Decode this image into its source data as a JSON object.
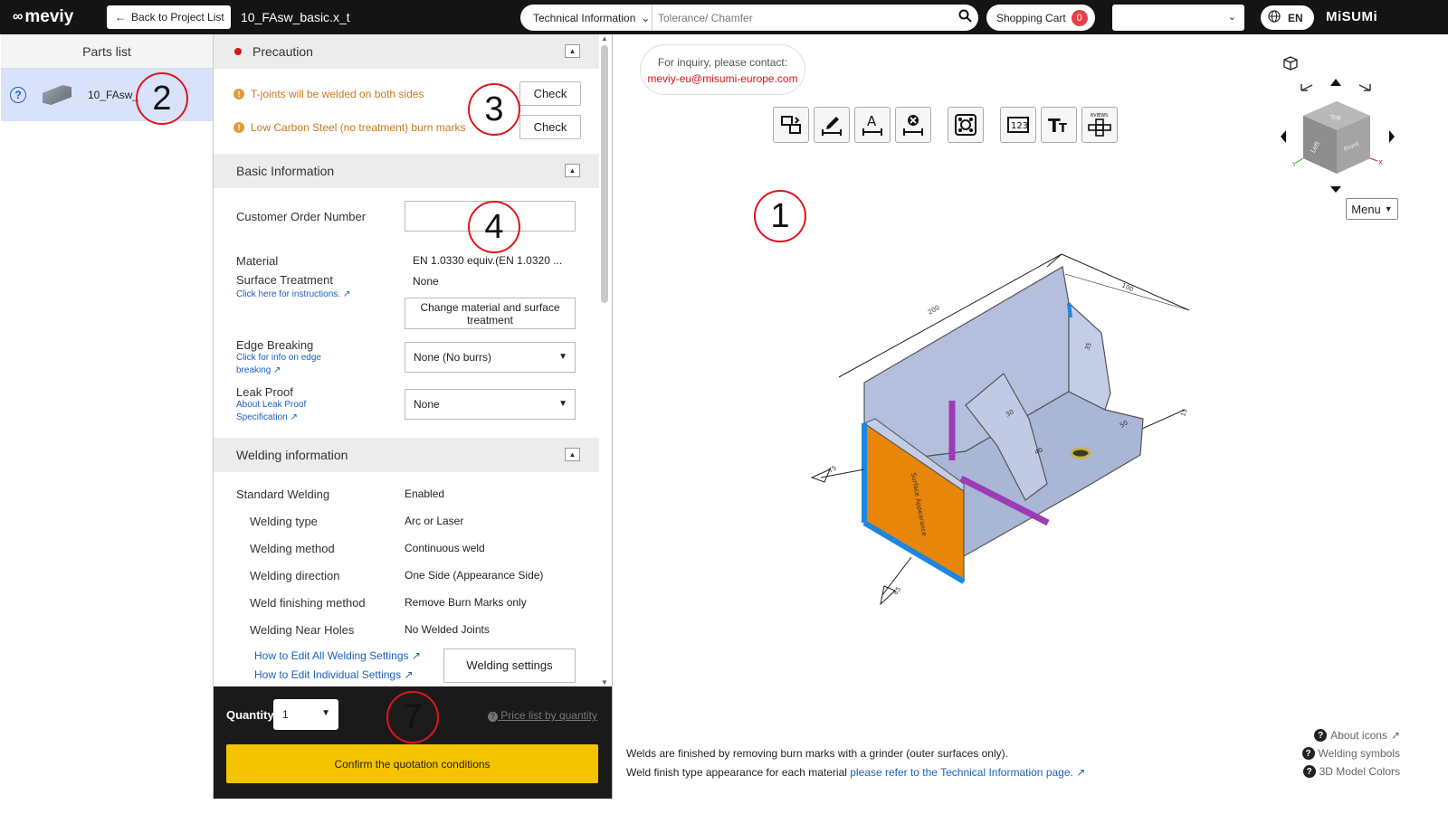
{
  "header": {
    "logo_text": "meviy",
    "back_label": "Back to Project List",
    "filename": "10_FAsw_basic.x_t",
    "search_category": "Technical Information",
    "search_placeholder": "Tolerance/ Chamfer",
    "cart_label": "Shopping Cart",
    "cart_count": "0",
    "language": "EN",
    "brand": "MiSUMi"
  },
  "parts": {
    "title": "Parts list",
    "item_label": "10_FAsw_"
  },
  "precaution": {
    "title": "Precaution",
    "items": [
      {
        "text": "T-joints will be welded on both sides",
        "button": "Check"
      },
      {
        "text": "Low Carbon Steel (no treatment) burn marks",
        "button": "Check"
      }
    ]
  },
  "basic": {
    "title": "Basic Information",
    "order_label": "Customer Order Number",
    "order_value": "",
    "material_label": "Material",
    "material_value": "EN 1.0330 equiv.(EN 1.0320 ...",
    "surface_label": "Surface Treatment",
    "surface_link": "Click here for instructions.",
    "surface_value": "None",
    "change_button": "Change material and surface treatment",
    "edge_label": "Edge Breaking",
    "edge_link": "Click for info on edge breaking",
    "edge_value": "None (No burrs)",
    "leak_label": "Leak Proof",
    "leak_link": "About Leak Proof Specification",
    "leak_value": "None"
  },
  "welding": {
    "title": "Welding information",
    "rows": [
      {
        "label": "Standard Welding",
        "value": "Enabled"
      },
      {
        "label": "Welding type",
        "value": "Arc or Laser"
      },
      {
        "label": "Welding method",
        "value": "Continuous weld"
      },
      {
        "label": "Welding direction",
        "value": "One Side (Appearance Side)"
      },
      {
        "label": "Weld finishing method",
        "value": "Remove Burn Marks only"
      },
      {
        "label": "Welding Near Holes",
        "value": "No Welded Joints"
      }
    ],
    "link_all": "How to Edit All Welding Settings",
    "link_individual": "How to Edit Individual Settings",
    "settings_button": "Welding settings"
  },
  "quote": {
    "qty_label": "Quantity",
    "qty_value": "1",
    "price_link": "Price list by quantity",
    "confirm": "Confirm the quotation conditions"
  },
  "viewer": {
    "inquiry_line1": "For inquiry, please contact:",
    "inquiry_line2": "meviy-eu@misumi-europe.com",
    "toolbar_icons": [
      "swap-part-icon",
      "edit-dimension-icon",
      "text-dimension-icon",
      "delete-dimension-icon",
      "hole-view-icon",
      "numbers-icon",
      "text-size-icon",
      "views-icon"
    ],
    "note1": "Welds are finished by removing burn marks with a grinder (outer surfaces only).",
    "note2_prefix": "Weld finish type appearance for each material ",
    "note2_link": "please refer to the Technical Information page.",
    "menu_label": "Menu",
    "about_icons": "About icons",
    "welding_symbols": "Welding symbols",
    "model_colors": "3D Model Colors",
    "cube_faces": [
      "Left",
      "Front",
      "Top"
    ],
    "dimension_labels": [
      "200",
      "100",
      "15",
      "85",
      "75",
      "30",
      "40",
      "50",
      "35"
    ],
    "part_face_label": "Surface Appearance"
  },
  "callouts": [
    "1",
    "2",
    "3",
    "4",
    "7"
  ],
  "colors": {
    "topbar": "#141414",
    "accent_yellow": "#f5c400",
    "part_gray": "#b3bfdc",
    "weld_orange": "#e8860a",
    "weld_blue": "#1d86e0",
    "weld_purple": "#9b3bb5",
    "callout_red": "#e0141a"
  }
}
